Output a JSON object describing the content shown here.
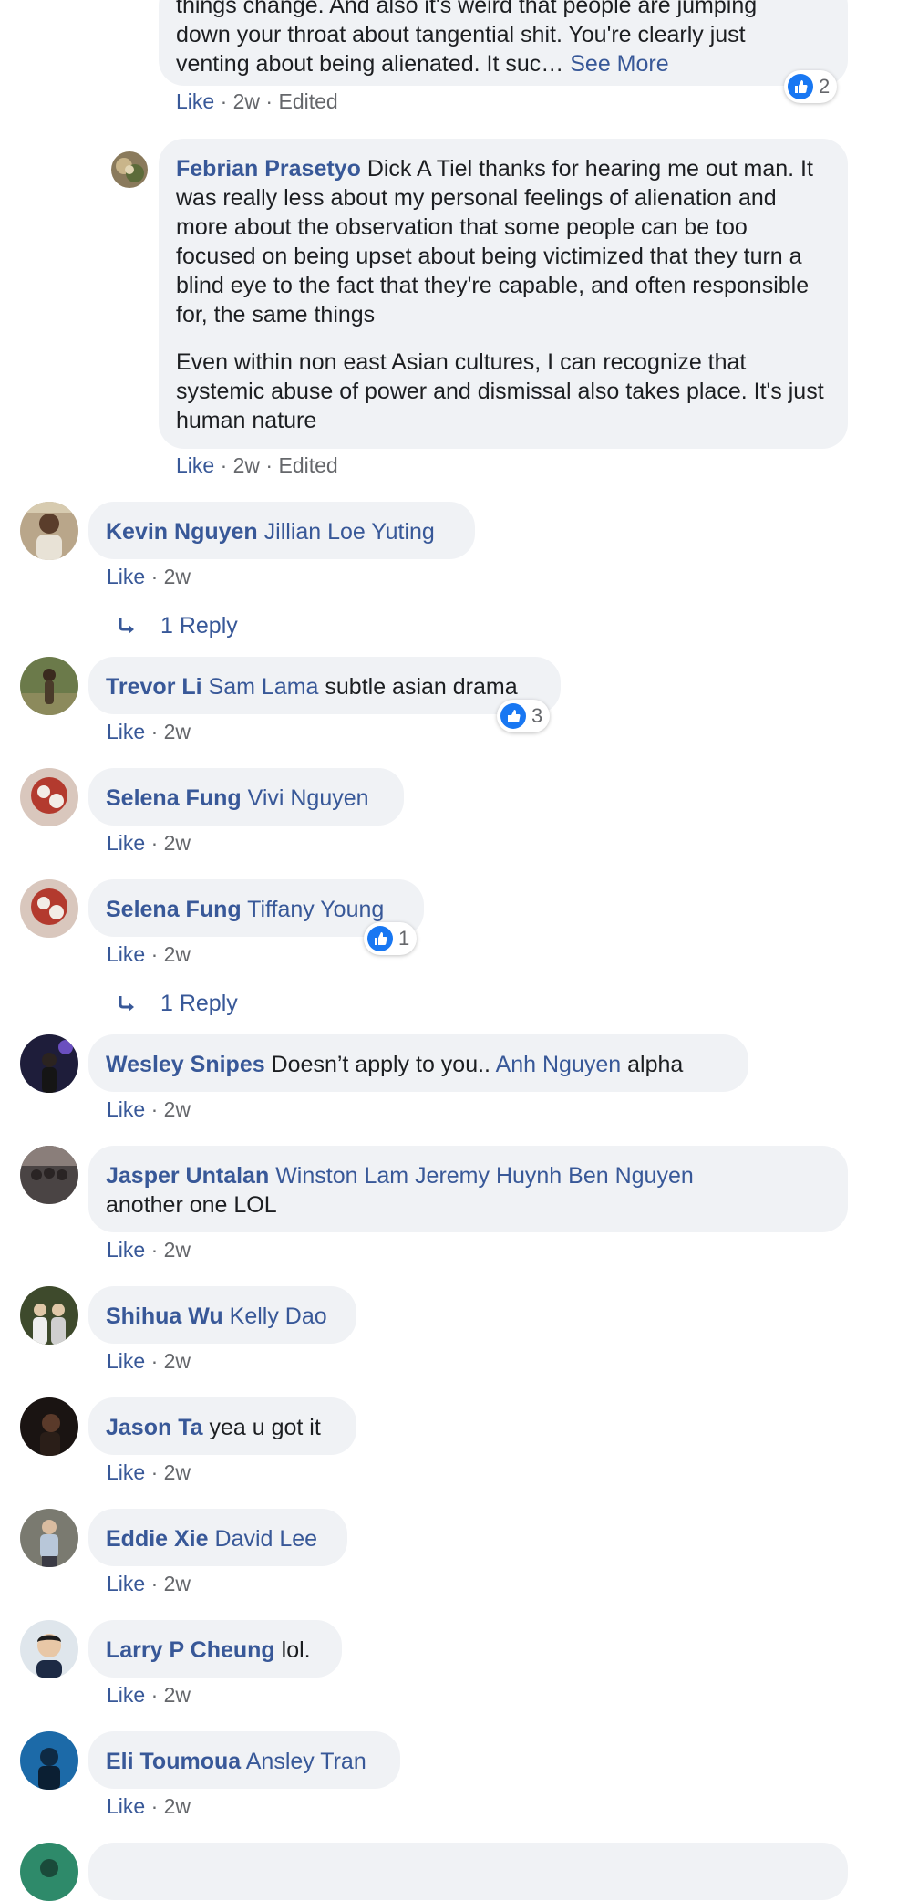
{
  "comments": {
    "c0": {
      "text_lines": [
        "things change. And also it's weird that people are jumping",
        "down your throat about tangential shit. You're clearly just",
        "venting about being alienated. It suc…"
      ],
      "see_more": "See More",
      "like": "Like",
      "meta": " · 2w · Edited",
      "reactions": "2"
    },
    "c1": {
      "name": "Febrian Prasetyo",
      "para1": "Dick A Tiel thanks for hearing me out man. It was really less about my personal feelings of alienation and more about the observation that some people can be too focused on being upset about being victimized that they turn a blind eye to the fact that they're capable, and often responsible for, the same things",
      "para2": "Even within non east Asian cultures, I can recognize that systemic abuse of power and dismissal also takes place. It's just human nature",
      "like": "Like",
      "meta": " · 2w · Edited"
    },
    "c2": {
      "name": "Kevin Nguyen",
      "tag": "Jillian Loe Yuting",
      "like": "Like",
      "meta": " · 2w",
      "reply": "1 Reply"
    },
    "c3": {
      "name": "Trevor Li",
      "tag": "Sam Lama",
      "text": "subtle asian drama",
      "like": "Like",
      "meta": " · 2w",
      "reactions": "3"
    },
    "c4": {
      "name": "Selena Fung",
      "tag": "Vivi Nguyen",
      "like": "Like",
      "meta": " · 2w"
    },
    "c5": {
      "name": "Selena Fung",
      "tag": "Tiffany Young",
      "like": "Like",
      "meta": " · 2w",
      "reactions": "1",
      "reply": "1 Reply"
    },
    "c6": {
      "name": "Wesley Snipes",
      "text1": "Doesn’t apply to you..",
      "tag": "Anh Nguyen",
      "text2": "alpha",
      "like": "Like",
      "meta": " · 2w"
    },
    "c7": {
      "name": "Jasper Untalan",
      "tags": "Winston Lam Jeremy Huynh Ben Nguyen",
      "text": "another one LOL",
      "like": "Like",
      "meta": " · 2w"
    },
    "c8": {
      "name": "Shihua Wu",
      "tag": "Kelly Dao",
      "like": "Like",
      "meta": " · 2w"
    },
    "c9": {
      "name": "Jason Ta",
      "text": "yea u got it",
      "like": "Like",
      "meta": " · 2w"
    },
    "c10": {
      "name": "Eddie Xie",
      "tag": "David Lee",
      "like": "Like",
      "meta": " · 2w"
    },
    "c11": {
      "name": "Larry P Cheung",
      "text": "lol.",
      "like": "Like",
      "meta": " · 2w"
    },
    "c12": {
      "name": "Eli Toumoua",
      "tag": "Ansley Tran",
      "like": "Like",
      "meta": " · 2w"
    }
  },
  "colors": {
    "link": "#385898",
    "bubble": "#f0f2f5",
    "meta": "#65676b",
    "like_badge": "#1877f2"
  }
}
